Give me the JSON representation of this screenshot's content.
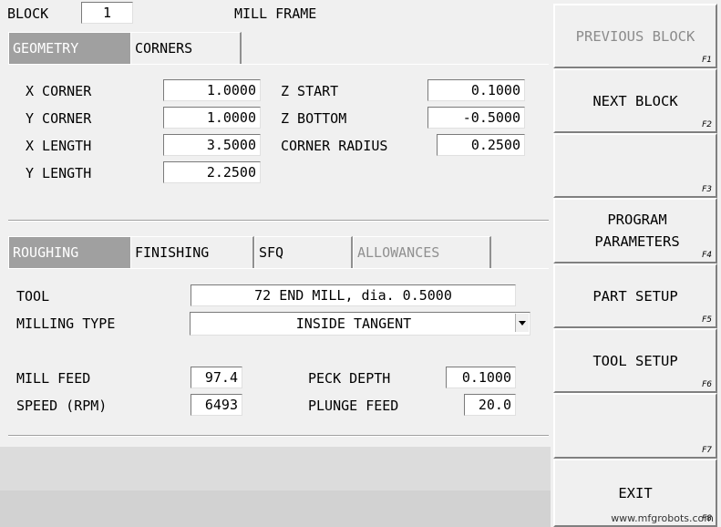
{
  "header": {
    "block_label": "BLOCK",
    "block_value": "1",
    "title": "MILL FRAME"
  },
  "geometry_tabs": [
    {
      "label": "GEOMETRY",
      "active": true
    },
    {
      "label": "CORNERS",
      "active": false
    }
  ],
  "geometry": {
    "x_corner": {
      "label": "X CORNER",
      "value": "1.0000"
    },
    "y_corner": {
      "label": "Y CORNER",
      "value": "1.0000"
    },
    "x_length": {
      "label": "X LENGTH",
      "value": "3.5000"
    },
    "y_length": {
      "label": "Y LENGTH",
      "value": "2.2500"
    },
    "z_start": {
      "label": "Z START",
      "value": "0.1000"
    },
    "z_bottom": {
      "label": "Z BOTTOM",
      "value": "-0.5000"
    },
    "corner_radius": {
      "label": "CORNER RADIUS",
      "value": "0.2500"
    }
  },
  "process_tabs": [
    {
      "label": "ROUGHING",
      "active": true
    },
    {
      "label": "FINISHING",
      "active": false
    },
    {
      "label": "SFQ",
      "active": false
    },
    {
      "label": "ALLOWANCES",
      "active": false,
      "disabled": true
    }
  ],
  "roughing": {
    "tool": {
      "label": "TOOL",
      "value": "72 END MILL, dia. 0.5000"
    },
    "milling_type": {
      "label": "MILLING TYPE",
      "value": "INSIDE TANGENT"
    },
    "mill_feed": {
      "label": "MILL FEED",
      "value": "97.4"
    },
    "speed": {
      "label": "SPEED (RPM)",
      "value": "6493"
    },
    "peck_depth": {
      "label": "PECK DEPTH",
      "value": "0.1000"
    },
    "plunge_feed": {
      "label": "PLUNGE FEED",
      "value": "20.0"
    }
  },
  "function_keys": [
    {
      "label": "PREVIOUS BLOCK",
      "key": "F1",
      "disabled": true
    },
    {
      "label": "NEXT BLOCK",
      "key": "F2"
    },
    {
      "label": "",
      "key": "F3"
    },
    {
      "label": "PROGRAM PARAMETERS",
      "key": "F4"
    },
    {
      "label": "PART SETUP",
      "key": "F5"
    },
    {
      "label": "TOOL SETUP",
      "key": "F6"
    },
    {
      "label": "",
      "key": "F7"
    },
    {
      "label": "EXIT",
      "key": "F8"
    }
  ],
  "watermark": "www.mfgrobots.com",
  "colors": {
    "background": "#f0f0f0",
    "active_tab": "#a0a0a0",
    "disabled_text": "#8c8c8c",
    "footer_band": "#dcdcdc"
  }
}
